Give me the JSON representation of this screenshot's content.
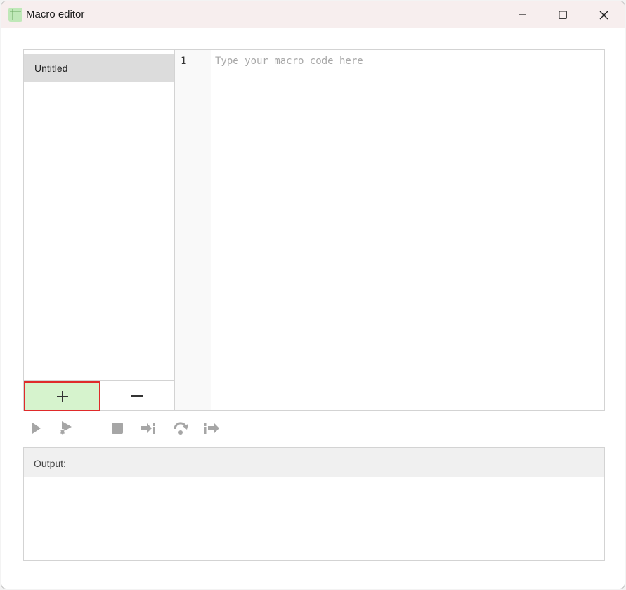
{
  "window": {
    "title": "Macro editor",
    "icon": "macro-editor-app-icon",
    "controls": [
      "minimize-icon",
      "maximize-icon",
      "close-icon"
    ]
  },
  "macros": {
    "items": [
      {
        "label": "Untitled",
        "selected": true
      }
    ],
    "add_button_icon": "plus-icon",
    "remove_button_icon": "minus-icon"
  },
  "editor": {
    "line_numbers": [
      "1"
    ],
    "placeholder": "Type your macro code here"
  },
  "toolbar": {
    "buttons": [
      {
        "icon": "run-icon",
        "enabled": false
      },
      {
        "icon": "debug-icon",
        "enabled": false
      },
      {
        "icon": "stop-icon",
        "enabled": false
      },
      {
        "icon": "step-into-icon",
        "enabled": false
      },
      {
        "icon": "step-over-icon",
        "enabled": false
      },
      {
        "icon": "step-out-icon",
        "enabled": false
      }
    ]
  },
  "output": {
    "label": "Output:",
    "content": ""
  },
  "colors": {
    "selection_bg": "#dcdcdc",
    "add_button_bg": "#d6f3cd",
    "highlight_border": "#e02a2a",
    "titlebar_bg": "#f7eeee",
    "disabled_icon": "#a6a6a6"
  }
}
